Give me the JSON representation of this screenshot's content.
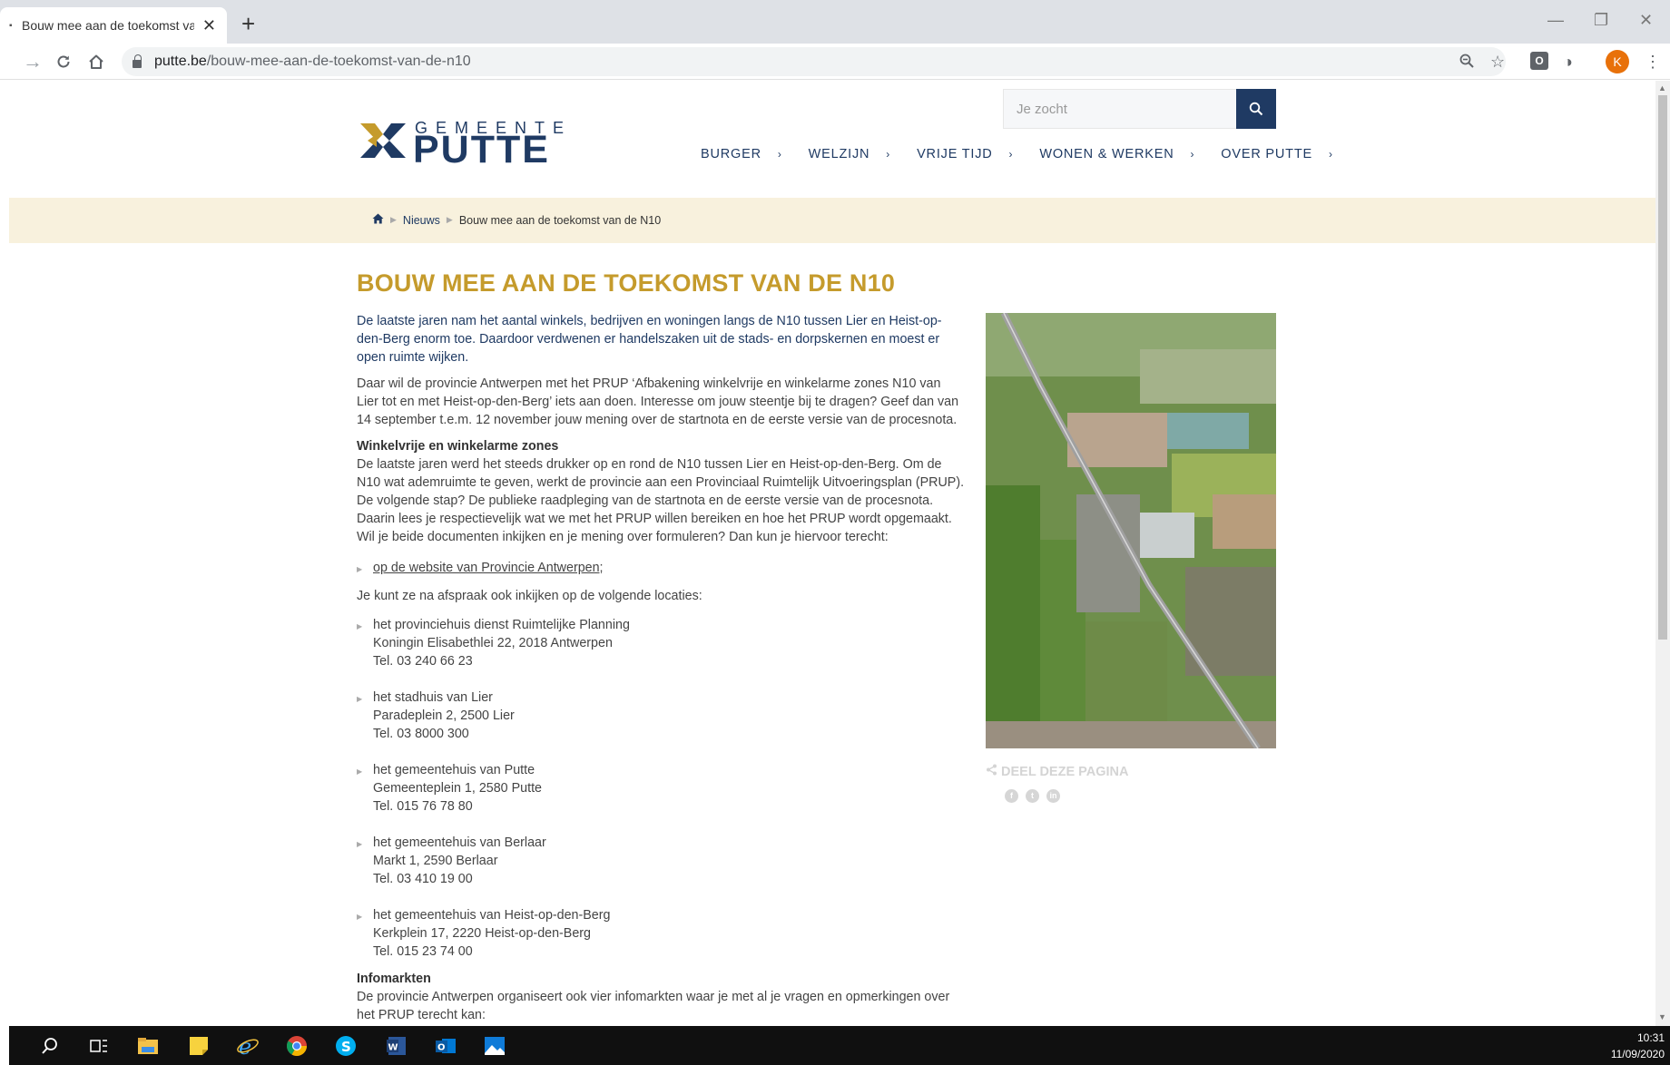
{
  "browser": {
    "tab_title": "Bouw mee aan de toekomst van de N10",
    "tab_close": "✕",
    "new_tab": "+",
    "url_host": "putte.be",
    "url_path": "/bouw-mee-aan-de-toekomst-van-de-n10",
    "profile_initial": "K",
    "win_minimize": "—",
    "win_restore": "❐",
    "win_close": "✕"
  },
  "site": {
    "logo_top": "GEMEENTE",
    "logo_main": "PUTTE",
    "search_placeholder": "Je zocht",
    "nav": [
      {
        "label": "BURGER"
      },
      {
        "label": "WELZIJN"
      },
      {
        "label": "VRIJE TIJD"
      },
      {
        "label": "WONEN & WERKEN"
      },
      {
        "label": "OVER PUTTE"
      }
    ],
    "nav_chevron": "›"
  },
  "breadcrumb": {
    "sep": "▶",
    "items": [
      "Nieuws",
      "Bouw mee aan de toekomst van de N10"
    ]
  },
  "article": {
    "title": "BOUW MEE AAN DE TOEKOMST VAN DE N10",
    "lead": "De laatste jaren nam het aantal winkels, bedrijven en woningen langs de N10 tussen Lier en Heist-op-den-Berg enorm toe. Daardoor verdwenen er handelszaken uit de stads- en dorpskernen en moest er open ruimte wijken.",
    "intro": "Daar wil de provincie Antwerpen met het PRUP ‘Afbakening winkelvrije en winkelarme zones N10 van Lier tot en met Heist-op-den-Berg’ iets aan doen. Interesse om jouw steentje bij te dragen? Geef dan van 14 september t.e.m. 12 november jouw mening over de startnota en de eerste versie van de procesnota.",
    "section1_heading": "Winkelvrije en winkelarme zones",
    "section1_body": "De laatste jaren werd het steeds drukker op en rond de N10 tussen Lier en Heist-op-den-Berg. Om de N10 wat ademruimte te geven, werkt de provincie aan een Provinciaal Ruimtelijk Uitvoeringsplan (PRUP). De volgende stap? De publieke raadpleging van de startnota en de eerste versie van de procesnota. Daarin lees je respectievelijk wat we met het PRUP willen bereiken en hoe het PRUP wordt opgemaakt. Wil je beide documenten inkijken en je mening over formuleren? Dan kun je hiervoor terecht:",
    "link_provincie": "op de website van Provincie Antwerpen;",
    "locations_intro": "Je kunt ze na afspraak ook inkijken op de volgende locaties:",
    "bullet_mark": "▶",
    "locations": [
      {
        "name": "het provinciehuis dienst Ruimtelijke Planning",
        "address": "Koningin Elisabethlei 22, 2018 Antwerpen",
        "tel": "Tel. 03 240 66 23"
      },
      {
        "name": "het stadhuis van Lier",
        "address": "Paradeplein 2, 2500 Lier",
        "tel": "Tel. 03 8000 300"
      },
      {
        "name": "het gemeentehuis van Putte",
        "address": "Gemeenteplein 1, 2580 Putte",
        "tel": "Tel. 015 76 78 80"
      },
      {
        "name": "het gemeentehuis van Berlaar",
        "address": "Markt 1, 2590 Berlaar",
        "tel": "Tel. 03 410 19 00"
      },
      {
        "name": "het gemeentehuis van Heist-op-den-Berg",
        "address": "Kerkplein 17, 2220 Heist-op-den-Berg",
        "tel": "Tel. 015 23 74 00"
      }
    ],
    "section2_heading": "Infomarkten",
    "section2_body": "De provincie Antwerpen organiseert ook vier infomarkten waar je met al je vragen en opmerkingen over het PRUP terecht kan:"
  },
  "share": {
    "label": "DEEL DEZE PAGINA",
    "icons": [
      "f",
      "t",
      "in"
    ]
  },
  "taskbar": {
    "time": "10:31",
    "date": "11/09/2020"
  }
}
